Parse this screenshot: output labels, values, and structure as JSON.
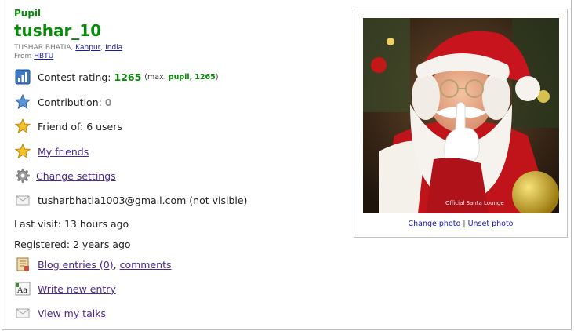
{
  "profile": {
    "rank": "Pupil",
    "handle": "tushar_10",
    "full_name": "TUSHAR BHATIA",
    "city": "Kanpur",
    "country": "India",
    "from_label": "From",
    "organization": "HBTU"
  },
  "stats": {
    "contest_rating_label": "Contest rating:",
    "contest_rating": "1265",
    "max_prefix": "(max.",
    "max_rank": "pupil,",
    "max_rating": "1265",
    "max_suffix": ")",
    "contribution_label": "Contribution:",
    "contribution": "0",
    "friend_of": "Friend of: 6 users"
  },
  "links": {
    "my_friends": "My friends",
    "change_settings": "Change settings",
    "blog_entries": "Blog entries (0)",
    "comma": ",",
    "comments": "comments",
    "write_new_entry": "Write new entry",
    "view_my_talks": "View my talks"
  },
  "email": "tusharbhatia1003@gmail.com (not visible)",
  "last_visit": "Last visit: 13 hours ago",
  "registered": "Registered: 2 years ago",
  "photo": {
    "change": "Change photo",
    "separator": "|",
    "unset": "Unset photo",
    "watermark": "Official Santa Lounge"
  },
  "colors": {
    "rank_color": "#0a8a0a",
    "link_color": "#4b2a8c"
  }
}
